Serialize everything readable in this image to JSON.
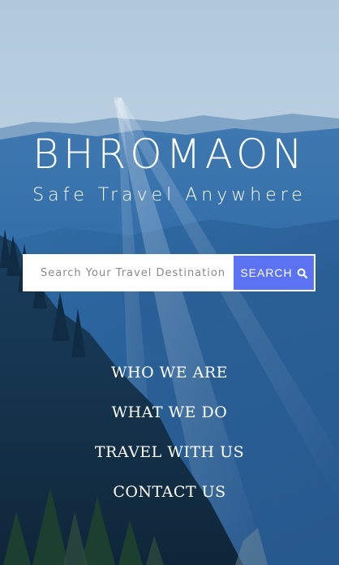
{
  "brand": {
    "name": "BHROMAON",
    "tagline": "Safe Travel Anywhere"
  },
  "search": {
    "placeholder": "Search Your Travel Destination",
    "value": "",
    "button_label": "SEARCH",
    "button_icon": "search-icon",
    "button_color": "#5b72f2"
  },
  "nav": {
    "items": [
      {
        "label": "WHO WE ARE"
      },
      {
        "label": "WHAT WE DO"
      },
      {
        "label": "TRAVEL WITH US"
      },
      {
        "label": "CONTACT US"
      }
    ]
  },
  "colors": {
    "sky": "#c3d6e6",
    "mountain": "#2c6ba6",
    "forest": "#14314a"
  }
}
